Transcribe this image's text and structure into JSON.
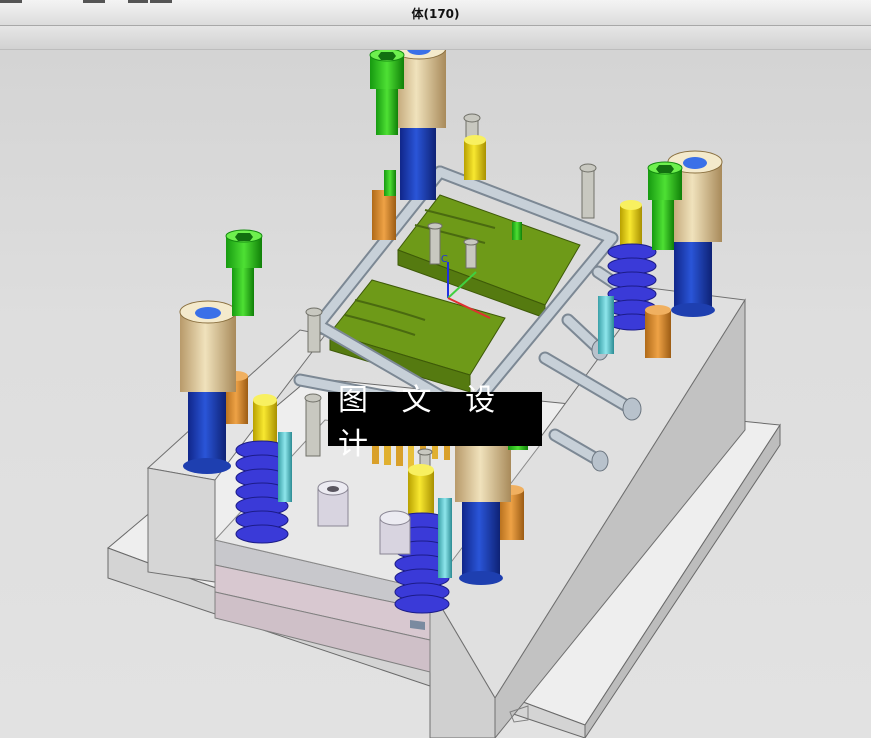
{
  "window": {
    "title": "体(170)"
  },
  "watermark": {
    "text": "图 文 设 计"
  },
  "triad": {
    "z_label": "ZC"
  },
  "colors": {
    "background": "#d8d8d8",
    "baseplate": "#e6e6e6",
    "guide_bushing": "#d8c8a0",
    "guide_pillar": "#1e3fb0",
    "screw_green": "#35c41e",
    "insert_olive": "#6e9a18",
    "spring_blue": "#3a3ad8",
    "ejector_yellow": "#e8d010",
    "spacer_orange": "#d98a2a",
    "frame_pipe": "#b8c2cc",
    "watermark_bg": "#000000"
  },
  "icons": [
    "hex-socket-screw-icon",
    "guide-pillar-icon",
    "spring-icon",
    "coordinate-triad-icon"
  ]
}
